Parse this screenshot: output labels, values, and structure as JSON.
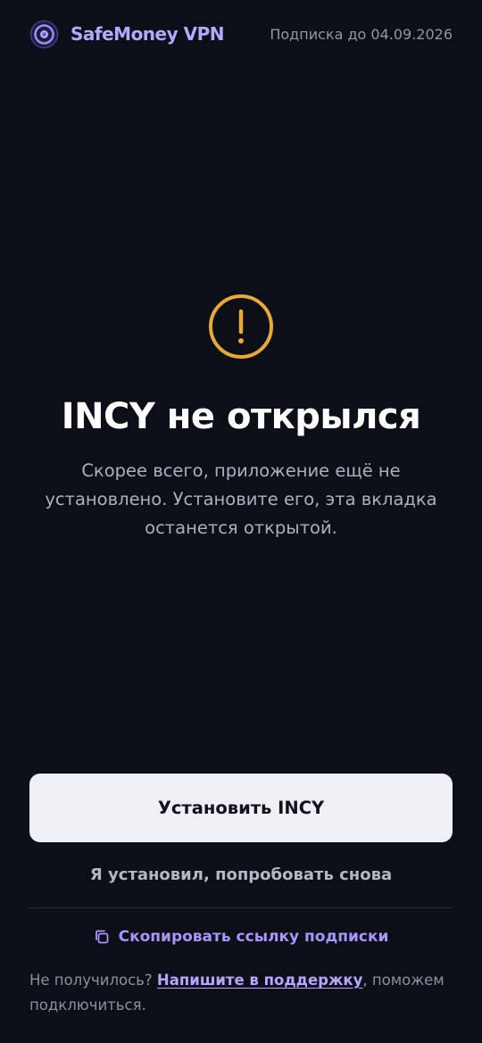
{
  "header": {
    "brand": "SafeMoney VPN",
    "subscription": "Подписка до 04.09.2026",
    "logo_icon": "vpn-logo-icon"
  },
  "main": {
    "icon": "warning-icon",
    "title": "INCY не открылся",
    "description": "Скорее всего, приложение ещё не установлено. Установите его, эта вкладка останется открытой."
  },
  "actions": {
    "install_label": "Установить INCY",
    "retry_label": "Я установил, попробовать снова",
    "copy_label": "Скопировать ссылку подписки",
    "copy_icon": "copy-icon"
  },
  "support": {
    "prefix": "Не получилось?",
    "link": "Напишите в поддержку",
    "suffix": ", поможем подключиться."
  },
  "colors": {
    "background": "#0c0f17",
    "accent": "#a895ff",
    "warning": "#e6a93a",
    "button_bg": "#eef0f6"
  }
}
